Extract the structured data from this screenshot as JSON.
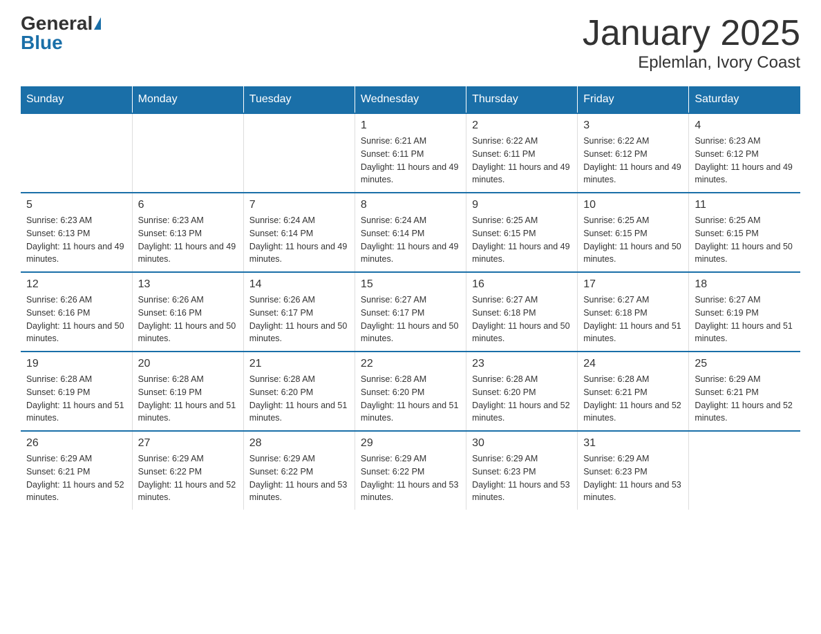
{
  "logo": {
    "general": "General",
    "blue": "Blue"
  },
  "title": "January 2025",
  "subtitle": "Eplemlan, Ivory Coast",
  "days_of_week": [
    "Sunday",
    "Monday",
    "Tuesday",
    "Wednesday",
    "Thursday",
    "Friday",
    "Saturday"
  ],
  "weeks": [
    [
      {
        "day": "",
        "info": ""
      },
      {
        "day": "",
        "info": ""
      },
      {
        "day": "",
        "info": ""
      },
      {
        "day": "1",
        "info": "Sunrise: 6:21 AM\nSunset: 6:11 PM\nDaylight: 11 hours and 49 minutes."
      },
      {
        "day": "2",
        "info": "Sunrise: 6:22 AM\nSunset: 6:11 PM\nDaylight: 11 hours and 49 minutes."
      },
      {
        "day": "3",
        "info": "Sunrise: 6:22 AM\nSunset: 6:12 PM\nDaylight: 11 hours and 49 minutes."
      },
      {
        "day": "4",
        "info": "Sunrise: 6:23 AM\nSunset: 6:12 PM\nDaylight: 11 hours and 49 minutes."
      }
    ],
    [
      {
        "day": "5",
        "info": "Sunrise: 6:23 AM\nSunset: 6:13 PM\nDaylight: 11 hours and 49 minutes."
      },
      {
        "day": "6",
        "info": "Sunrise: 6:23 AM\nSunset: 6:13 PM\nDaylight: 11 hours and 49 minutes."
      },
      {
        "day": "7",
        "info": "Sunrise: 6:24 AM\nSunset: 6:14 PM\nDaylight: 11 hours and 49 minutes."
      },
      {
        "day": "8",
        "info": "Sunrise: 6:24 AM\nSunset: 6:14 PM\nDaylight: 11 hours and 49 minutes."
      },
      {
        "day": "9",
        "info": "Sunrise: 6:25 AM\nSunset: 6:15 PM\nDaylight: 11 hours and 49 minutes."
      },
      {
        "day": "10",
        "info": "Sunrise: 6:25 AM\nSunset: 6:15 PM\nDaylight: 11 hours and 50 minutes."
      },
      {
        "day": "11",
        "info": "Sunrise: 6:25 AM\nSunset: 6:15 PM\nDaylight: 11 hours and 50 minutes."
      }
    ],
    [
      {
        "day": "12",
        "info": "Sunrise: 6:26 AM\nSunset: 6:16 PM\nDaylight: 11 hours and 50 minutes."
      },
      {
        "day": "13",
        "info": "Sunrise: 6:26 AM\nSunset: 6:16 PM\nDaylight: 11 hours and 50 minutes."
      },
      {
        "day": "14",
        "info": "Sunrise: 6:26 AM\nSunset: 6:17 PM\nDaylight: 11 hours and 50 minutes."
      },
      {
        "day": "15",
        "info": "Sunrise: 6:27 AM\nSunset: 6:17 PM\nDaylight: 11 hours and 50 minutes."
      },
      {
        "day": "16",
        "info": "Sunrise: 6:27 AM\nSunset: 6:18 PM\nDaylight: 11 hours and 50 minutes."
      },
      {
        "day": "17",
        "info": "Sunrise: 6:27 AM\nSunset: 6:18 PM\nDaylight: 11 hours and 51 minutes."
      },
      {
        "day": "18",
        "info": "Sunrise: 6:27 AM\nSunset: 6:19 PM\nDaylight: 11 hours and 51 minutes."
      }
    ],
    [
      {
        "day": "19",
        "info": "Sunrise: 6:28 AM\nSunset: 6:19 PM\nDaylight: 11 hours and 51 minutes."
      },
      {
        "day": "20",
        "info": "Sunrise: 6:28 AM\nSunset: 6:19 PM\nDaylight: 11 hours and 51 minutes."
      },
      {
        "day": "21",
        "info": "Sunrise: 6:28 AM\nSunset: 6:20 PM\nDaylight: 11 hours and 51 minutes."
      },
      {
        "day": "22",
        "info": "Sunrise: 6:28 AM\nSunset: 6:20 PM\nDaylight: 11 hours and 51 minutes."
      },
      {
        "day": "23",
        "info": "Sunrise: 6:28 AM\nSunset: 6:20 PM\nDaylight: 11 hours and 52 minutes."
      },
      {
        "day": "24",
        "info": "Sunrise: 6:28 AM\nSunset: 6:21 PM\nDaylight: 11 hours and 52 minutes."
      },
      {
        "day": "25",
        "info": "Sunrise: 6:29 AM\nSunset: 6:21 PM\nDaylight: 11 hours and 52 minutes."
      }
    ],
    [
      {
        "day": "26",
        "info": "Sunrise: 6:29 AM\nSunset: 6:21 PM\nDaylight: 11 hours and 52 minutes."
      },
      {
        "day": "27",
        "info": "Sunrise: 6:29 AM\nSunset: 6:22 PM\nDaylight: 11 hours and 52 minutes."
      },
      {
        "day": "28",
        "info": "Sunrise: 6:29 AM\nSunset: 6:22 PM\nDaylight: 11 hours and 53 minutes."
      },
      {
        "day": "29",
        "info": "Sunrise: 6:29 AM\nSunset: 6:22 PM\nDaylight: 11 hours and 53 minutes."
      },
      {
        "day": "30",
        "info": "Sunrise: 6:29 AM\nSunset: 6:23 PM\nDaylight: 11 hours and 53 minutes."
      },
      {
        "day": "31",
        "info": "Sunrise: 6:29 AM\nSunset: 6:23 PM\nDaylight: 11 hours and 53 minutes."
      },
      {
        "day": "",
        "info": ""
      }
    ]
  ]
}
